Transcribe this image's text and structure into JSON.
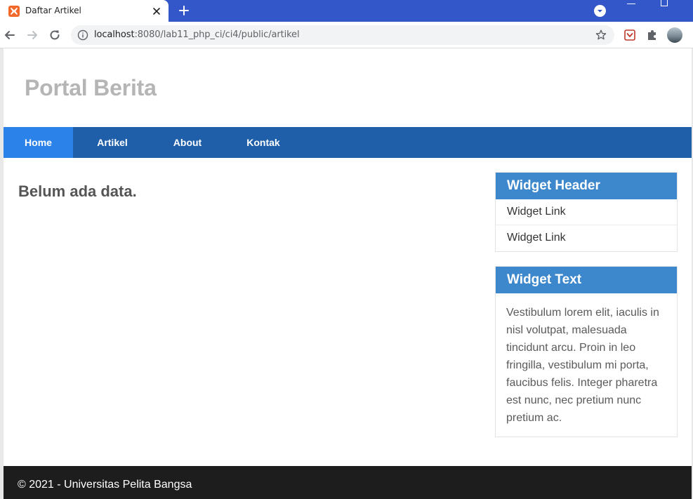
{
  "browser": {
    "tab_title": "Daftar Artikel",
    "url_host": "localhost",
    "url_rest": ":8080/lab11_php_ci/ci4/public/artikel"
  },
  "icons": {
    "favicon": "xampp-icon",
    "close": "close-icon",
    "new_tab": "plus-icon",
    "back": "arrow-left-icon",
    "forward": "arrow-right-icon",
    "reload": "reload-icon",
    "info": "info-icon",
    "bookmark": "star-icon",
    "extension_1": "shield-icon",
    "extension_2": "puzzle-icon",
    "profile": "avatar"
  },
  "site": {
    "title": "Portal Berita",
    "nav": [
      {
        "label": "Home",
        "active": true
      },
      {
        "label": "Artikel",
        "active": false
      },
      {
        "label": "About",
        "active": false
      },
      {
        "label": "Kontak",
        "active": false
      }
    ],
    "main_message": "Belum ada data.",
    "sidebar": {
      "links_widget": {
        "header": "Widget Header",
        "links": [
          "Widget Link",
          "Widget Link"
        ]
      },
      "text_widget": {
        "header": "Widget Text",
        "body": "Vestibulum lorem elit, iaculis in nisl volutpat, malesuada tincidunt arcu. Proin in leo fringilla, vestibulum mi porta, faucibus felis. Integer pharetra est nunc, nec pretium nunc pretium ac."
      }
    },
    "footer": "© 2021 - Universitas Pelita Bangsa"
  },
  "colors": {
    "tabbar": "#3357c8",
    "nav": "#1f5faa",
    "nav_active": "#2b83ea",
    "widget_header": "#3d88cc",
    "footer": "#1d1d1d"
  }
}
